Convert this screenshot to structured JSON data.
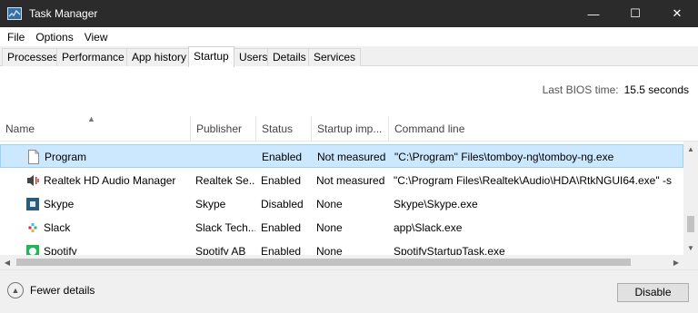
{
  "window": {
    "title": "Task Manager",
    "controls": {
      "minimize": "—",
      "maximize": "☐",
      "close": "✕"
    }
  },
  "menu": [
    "File",
    "Options",
    "View"
  ],
  "tabs": [
    {
      "label": "Processes"
    },
    {
      "label": "Performance"
    },
    {
      "label": "App history"
    },
    {
      "label": "Startup",
      "active": true
    },
    {
      "label": "Users"
    },
    {
      "label": "Details"
    },
    {
      "label": "Services"
    }
  ],
  "bios": {
    "label": "Last BIOS time:",
    "value": "15.5 seconds"
  },
  "columns": {
    "name": "Name",
    "publisher": "Publisher",
    "status": "Status",
    "impact": "Startup imp...",
    "command": "Command line"
  },
  "rows": [
    {
      "name": "Program",
      "publisher": "",
      "status": "Enabled",
      "impact": "Not measured",
      "command": "\"C:\\Program\" Files\\tomboy-ng\\tomboy-ng.exe",
      "icon": "file-icon",
      "selected": true
    },
    {
      "name": "Realtek HD Audio Manager",
      "publisher": "Realtek Se...",
      "status": "Enabled",
      "impact": "Not measured",
      "command": "\"C:\\Program Files\\Realtek\\Audio\\HDA\\RtkNGUI64.exe\" -s",
      "icon": "speaker-icon"
    },
    {
      "name": "Skype",
      "publisher": "Skype",
      "status": "Disabled",
      "impact": "None",
      "command": "Skype\\Skype.exe",
      "icon": "skype-icon"
    },
    {
      "name": "Slack",
      "publisher": "Slack Tech...",
      "status": "Enabled",
      "impact": "None",
      "command": "app\\Slack.exe",
      "icon": "slack-icon"
    },
    {
      "name": "Spotify",
      "publisher": "Spotify AB",
      "status": "Enabled",
      "impact": "None",
      "command": "SpotifyStartupTask.exe",
      "icon": "spotify-icon"
    }
  ],
  "footer": {
    "fewer_details": "Fewer details",
    "disable_button": "Disable"
  },
  "colors": {
    "titlebar": "#2b2b2b",
    "selection": "#cce8ff",
    "spotify": "#1db954",
    "skype_box": "#2b5b7d"
  }
}
